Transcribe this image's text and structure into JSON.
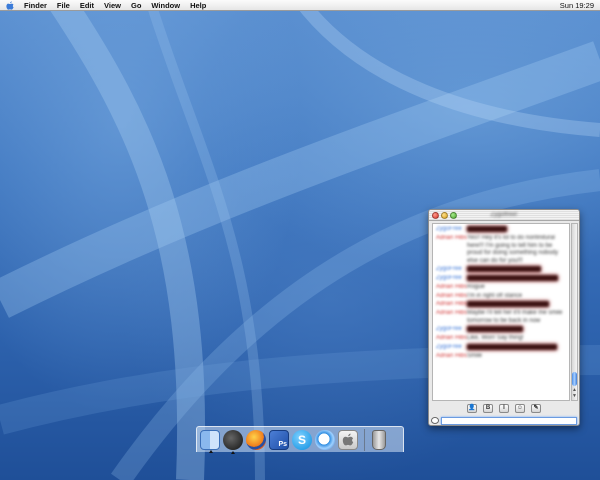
{
  "menubar": {
    "items": [
      "Finder",
      "File",
      "Edit",
      "View",
      "Go",
      "Window",
      "Help"
    ],
    "clock": "Sun 19:29"
  },
  "chat_window": {
    "title": "Zygoffree!",
    "messages": [
      {
        "sender": "ZygoFree",
        "text": "",
        "style": "s1"
      },
      {
        "sender": "Adrian Hibs",
        "text": "Yes!! Hey it's lol to do nonfinitural here!!! I'm going to tell him to be proud for doing something nobody else can do for you!!!",
        "style": "s2"
      },
      {
        "sender": "ZygoFree",
        "text": "",
        "style": "s1"
      },
      {
        "sender": "ZygoFree",
        "text": "",
        "style": "s1"
      },
      {
        "sender": "Adrian Hibs",
        "text": "Rogue",
        "style": "s2"
      },
      {
        "sender": "Adrian Hibs",
        "text": "I'm in right off stance",
        "style": "s2"
      },
      {
        "sender": "Adrian Hibs",
        "text": "",
        "style": "s2"
      },
      {
        "sender": "Adrian Hibs",
        "text": "Maybe I'll tell her it'll make me smile tomorrow to be back in now",
        "style": "s2"
      },
      {
        "sender": "ZygoFree",
        "text": "",
        "style": "s1"
      },
      {
        "sender": "Adrian Hibs",
        "text": "Like, Won! Say thing!",
        "style": "s2"
      },
      {
        "sender": "ZygoFree",
        "text": "",
        "style": "s1"
      },
      {
        "sender": "Adrian Hibs",
        "text": "Smile",
        "style": "s2"
      }
    ],
    "toolbar_buttons": [
      {
        "name": "buddy-button",
        "glyph": "👤"
      },
      {
        "name": "bold-button",
        "glyph": "B"
      },
      {
        "name": "italic-button",
        "glyph": "I"
      },
      {
        "name": "smiley-button",
        "glyph": "☺"
      },
      {
        "name": "attach-button",
        "glyph": "✎"
      }
    ],
    "input_value": ""
  },
  "dock": {
    "items": [
      {
        "name": "finder-icon",
        "kind": "finder",
        "running": true
      },
      {
        "name": "ichat-icon",
        "kind": "ichat",
        "running": true
      },
      {
        "name": "firefox-icon",
        "kind": "firefox",
        "running": false
      },
      {
        "name": "photoshop-icon",
        "kind": "photoshop",
        "label": "Ps",
        "running": false
      },
      {
        "name": "skype-icon",
        "kind": "skype",
        "label": "S",
        "running": false
      },
      {
        "name": "safari-icon",
        "kind": "safari",
        "running": false
      },
      {
        "name": "system-preferences-icon",
        "kind": "sysprefs",
        "label": "",
        "running": false
      }
    ]
  }
}
